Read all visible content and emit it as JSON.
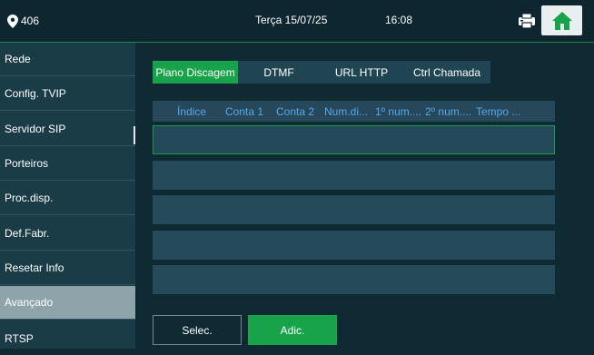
{
  "topbar": {
    "location_label": "406",
    "date": "Terça 15/07/25",
    "time": "16:08"
  },
  "sidebar": {
    "items": [
      {
        "label": "Rede"
      },
      {
        "label": "Config. TVIP"
      },
      {
        "label": "Servidor SIP"
      },
      {
        "label": "Porteiros"
      },
      {
        "label": "Proc.disp."
      },
      {
        "label": "Def.Fabr."
      },
      {
        "label": "Resetar Info"
      },
      {
        "label": "Avançado",
        "active": true
      },
      {
        "label": "RTSP"
      }
    ]
  },
  "tabs": [
    {
      "label": "Plano Discagem",
      "active": true
    },
    {
      "label": "DTMF"
    },
    {
      "label": "URL HTTP"
    },
    {
      "label": "Ctrl Chamada"
    }
  ],
  "table": {
    "columns": [
      "Índice",
      "Conta 1",
      "Conta 2",
      "Num.di...",
      "1º num....",
      "2º num....",
      "Tempo ..."
    ],
    "rows": [
      {
        "selected": true
      },
      {},
      {},
      {},
      {}
    ]
  },
  "buttons": {
    "select_label": "Selec.",
    "add_label": "Adic."
  },
  "colors": {
    "accent": "#18a34a",
    "header_text": "#54a8ec",
    "background": "#0f2a33",
    "sidebar": "#1a3c47"
  }
}
